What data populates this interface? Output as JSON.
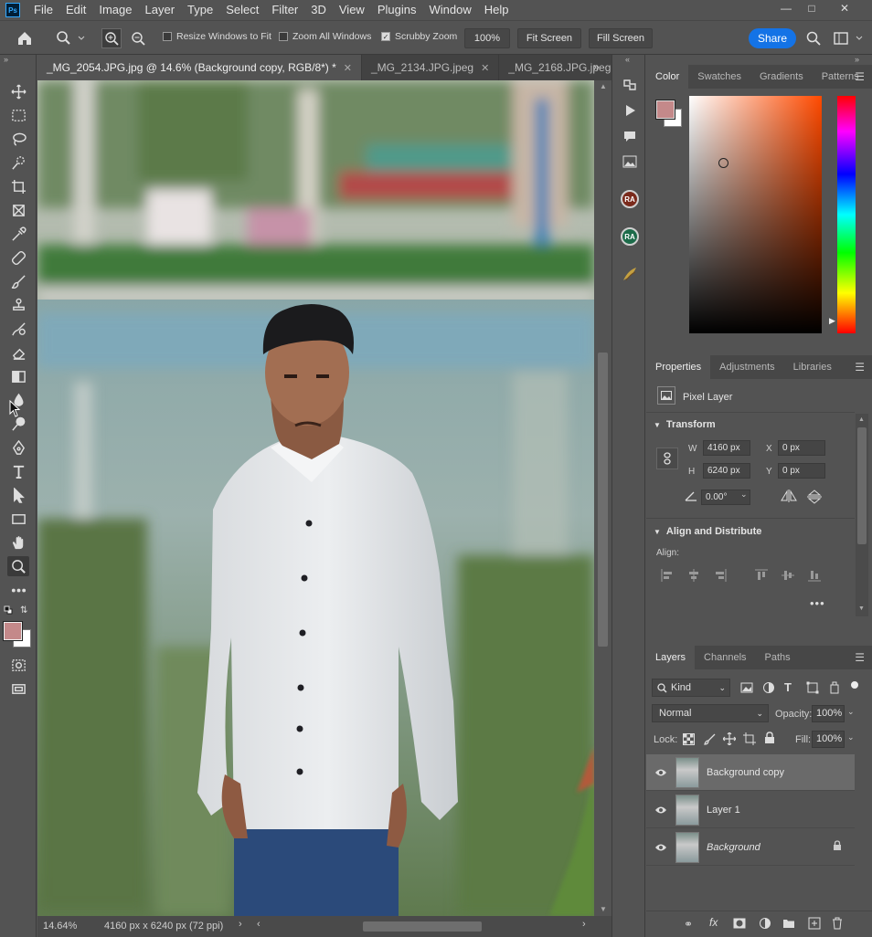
{
  "menu": {
    "items": [
      "File",
      "Edit",
      "Image",
      "Layer",
      "Type",
      "Select",
      "Filter",
      "3D",
      "View",
      "Plugins",
      "Window",
      "Help"
    ],
    "logo": "Ps"
  },
  "options": {
    "resize_windows": "Resize Windows to Fit",
    "zoom_all": "Zoom All Windows",
    "scrubby": "Scrubby Zoom",
    "zoom_value": "100%",
    "fit_screen": "Fit Screen",
    "fill_screen": "Fill Screen",
    "share": "Share",
    "resize_checked": false,
    "zoom_all_checked": false,
    "scrubby_checked": true
  },
  "tabs": [
    {
      "label": "_MG_2054.JPG.jpg @ 14.6% (Background copy, RGB/8*) *"
    },
    {
      "label": "_MG_2134.JPG.jpeg"
    },
    {
      "label": "_MG_2168.JPG.jpeg"
    }
  ],
  "status": {
    "zoom": "14.64%",
    "doc": "4160 px x 6240 px (72 ppi)"
  },
  "colorPanel": {
    "tabs": [
      "Color",
      "Swatches",
      "Gradients",
      "Patterns"
    ],
    "foreground": "#c4898a",
    "hue": "#ff4a00"
  },
  "properties": {
    "tabs": [
      "Properties",
      "Adjustments",
      "Libraries"
    ],
    "type": "Pixel Layer",
    "transform_title": "Transform",
    "w_label": "W",
    "w": "4160 px",
    "h_label": "H",
    "h": "6240 px",
    "x_label": "X",
    "x": "0 px",
    "y_label": "Y",
    "y": "0 px",
    "angle": "0.00°",
    "align_title": "Align and Distribute",
    "align_label": "Align:"
  },
  "layersPanel": {
    "tabs": [
      "Layers",
      "Channels",
      "Paths"
    ],
    "kind": "Kind",
    "blend": "Normal",
    "opacity_label": "Opacity:",
    "opacity": "100%",
    "lock_label": "Lock:",
    "fill_label": "Fill:",
    "fill": "100%",
    "layers": [
      {
        "name": "Background copy",
        "selected": true
      },
      {
        "name": "Layer 1",
        "selected": false
      },
      {
        "name": "Background",
        "selected": false,
        "italic": true,
        "locked": true
      }
    ]
  },
  "midstrip": {
    "ra1": "RA",
    "ra2": "RA"
  }
}
